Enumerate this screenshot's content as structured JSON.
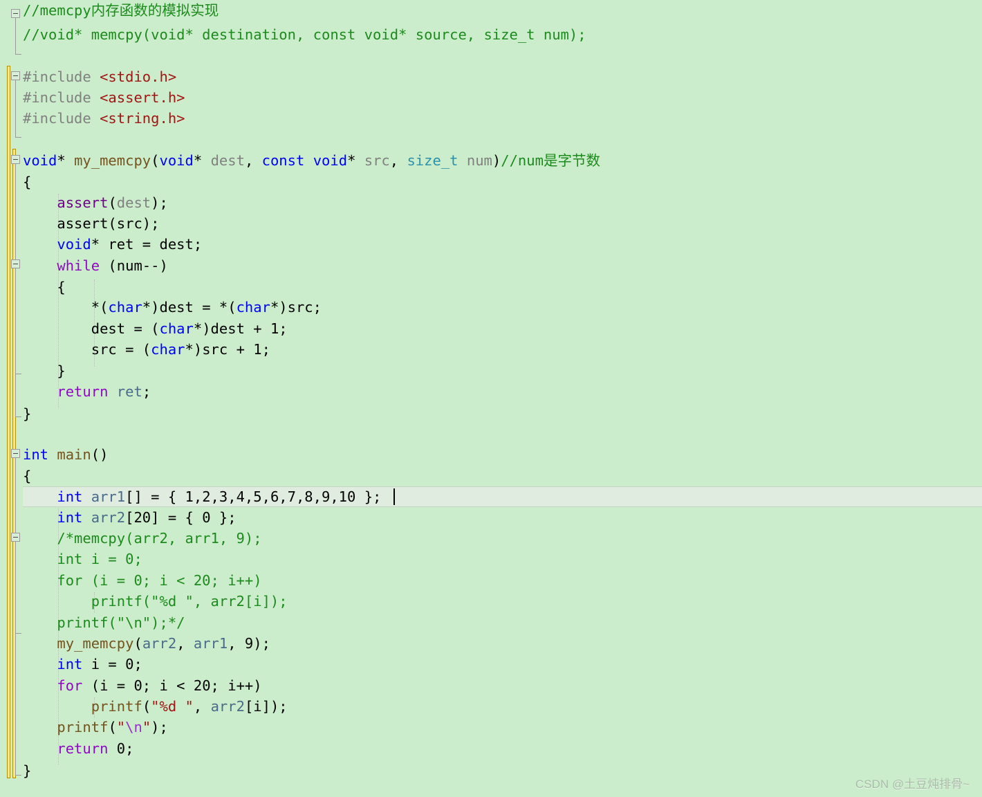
{
  "editor": {
    "name": "visual-studio-code-editor",
    "language": "C",
    "background_color": "#cbedcb",
    "current_line_color": "#dfecdf",
    "change_bar_color": "#f5e79a",
    "font_size_px": 20.5,
    "line_height_px": 30
  },
  "palette": {
    "comment": "#1d8a1d",
    "keyword": "#0000ff",
    "control_keyword": "#8f08c4",
    "preprocessor": "#808080",
    "include_path": "#a31515",
    "string": "#a31515",
    "escape": "#9a2ece",
    "type": "#2b91af",
    "function": "#74531f",
    "variable": "#4a6a8a",
    "parameter": "#808080",
    "macro": "#6f008a",
    "plain": "#000000"
  },
  "caret": {
    "line_index": 24,
    "column_after": "int arr1[] = { 1,2,3,4,5,6,7,8,9,10 };"
  },
  "current_line": {
    "index": 24,
    "text": "    int arr1[] = { 1,2,3,4,5,6,7,8,9,10 };"
  },
  "watermark": {
    "text": "CSDN @土豆炖排骨~"
  },
  "code_lines": [
    {
      "n": 1,
      "indent": 0,
      "text": "//memcpy内存函数的模拟实现"
    },
    {
      "n": 2,
      "indent": 0,
      "text": "//void* memcpy(void* destination, const void* source, size_t num);"
    },
    {
      "n": 3,
      "indent": 0,
      "text": ""
    },
    {
      "n": 4,
      "indent": 0,
      "text": "#include <stdio.h>"
    },
    {
      "n": 5,
      "indent": 0,
      "text": "#include <assert.h>"
    },
    {
      "n": 6,
      "indent": 0,
      "text": "#include <string.h>"
    },
    {
      "n": 7,
      "indent": 0,
      "text": ""
    },
    {
      "n": 8,
      "indent": 0,
      "text": "void* my_memcpy(void* dest, const void* src, size_t num)//num是字节数"
    },
    {
      "n": 9,
      "indent": 0,
      "text": "{"
    },
    {
      "n": 10,
      "indent": 1,
      "text": "    assert(dest);"
    },
    {
      "n": 11,
      "indent": 1,
      "text": "    assert(src);"
    },
    {
      "n": 12,
      "indent": 1,
      "text": "    void* ret = dest;"
    },
    {
      "n": 13,
      "indent": 1,
      "text": "    while (num--)"
    },
    {
      "n": 14,
      "indent": 1,
      "text": "    {"
    },
    {
      "n": 15,
      "indent": 2,
      "text": "        *(char*)dest = *(char*)src;"
    },
    {
      "n": 16,
      "indent": 2,
      "text": "        dest = (char*)dest + 1;"
    },
    {
      "n": 17,
      "indent": 2,
      "text": "        src = (char*)src + 1;"
    },
    {
      "n": 18,
      "indent": 1,
      "text": "    }"
    },
    {
      "n": 19,
      "indent": 1,
      "text": "    return ret;"
    },
    {
      "n": 20,
      "indent": 0,
      "text": "}"
    },
    {
      "n": 21,
      "indent": 0,
      "text": ""
    },
    {
      "n": 22,
      "indent": 0,
      "text": "int main()"
    },
    {
      "n": 23,
      "indent": 0,
      "text": "{"
    },
    {
      "n": 24,
      "indent": 1,
      "text": "    int arr1[] = { 1,2,3,4,5,6,7,8,9,10 };"
    },
    {
      "n": 25,
      "indent": 1,
      "text": "    int arr2[20] = { 0 };"
    },
    {
      "n": 26,
      "indent": 1,
      "text": "    /*memcpy(arr2, arr1, 9);"
    },
    {
      "n": 27,
      "indent": 1,
      "text": "    int i = 0;"
    },
    {
      "n": 28,
      "indent": 1,
      "text": "    for (i = 0; i < 20; i++)"
    },
    {
      "n": 29,
      "indent": 2,
      "text": "        printf(\"%d \", arr2[i]);"
    },
    {
      "n": 30,
      "indent": 1,
      "text": "    printf(\"\\n\");*/"
    },
    {
      "n": 31,
      "indent": 1,
      "text": "    my_memcpy(arr2, arr1, 9);"
    },
    {
      "n": 32,
      "indent": 1,
      "text": "    int i = 0;"
    },
    {
      "n": 33,
      "indent": 1,
      "text": "    for (i = 0; i < 20; i++)"
    },
    {
      "n": 34,
      "indent": 2,
      "text": "        printf(\"%d \", arr2[i]);"
    },
    {
      "n": 35,
      "indent": 1,
      "text": "    printf(\"\\n\");"
    },
    {
      "n": 36,
      "indent": 1,
      "text": "    return 0;"
    },
    {
      "n": 37,
      "indent": 0,
      "text": "}"
    }
  ],
  "tokens": {
    "l1": [
      [
        "//memcpy内存函数的模拟实现",
        "cmt"
      ]
    ],
    "l2": [
      [
        "//void* memcpy(void* destination, const void* source, size_t num);",
        "cmt"
      ]
    ],
    "l4": [
      [
        "#include ",
        "pre"
      ],
      [
        "<stdio.h>",
        "inc"
      ]
    ],
    "l5": [
      [
        "#include ",
        "pre"
      ],
      [
        "<assert.h>",
        "inc"
      ]
    ],
    "l6": [
      [
        "#include ",
        "pre"
      ],
      [
        "<string.h>",
        "inc"
      ]
    ],
    "l8": [
      [
        "void",
        "kw"
      ],
      [
        "* ",
        "plain"
      ],
      [
        "my_memcpy",
        "fn"
      ],
      [
        "(",
        "plain"
      ],
      [
        "void",
        "kw"
      ],
      [
        "* ",
        "plain"
      ],
      [
        "dest",
        "param"
      ],
      [
        ", ",
        "plain"
      ],
      [
        "const",
        "kw"
      ],
      [
        " ",
        "plain"
      ],
      [
        "void",
        "kw"
      ],
      [
        "* ",
        "plain"
      ],
      [
        "src",
        "param"
      ],
      [
        ", ",
        "plain"
      ],
      [
        "size_t",
        "type"
      ],
      [
        " ",
        "plain"
      ],
      [
        "num",
        "param"
      ],
      [
        ")",
        "plain"
      ],
      [
        "//num是字节数",
        "cmt"
      ]
    ],
    "l9": [
      [
        "{",
        "plain"
      ]
    ],
    "l10": [
      [
        "    ",
        "plain"
      ],
      [
        "assert",
        "macro"
      ],
      [
        "(",
        "plain"
      ],
      [
        "dest",
        "param"
      ],
      [
        ");",
        "plain"
      ]
    ],
    "l11": [
      [
        "    assert(src);",
        "plain"
      ]
    ],
    "l12": [
      [
        "    ",
        "plain"
      ],
      [
        "void",
        "kw"
      ],
      [
        "* ret = dest;",
        "plain"
      ]
    ],
    "l13": [
      [
        "    ",
        "plain"
      ],
      [
        "while",
        "ctl"
      ],
      [
        " (num--)",
        "plain"
      ]
    ],
    "l14": [
      [
        "    {",
        "plain"
      ]
    ],
    "l15": [
      [
        "        *(",
        "plain"
      ],
      [
        "char",
        "kw"
      ],
      [
        "*)dest = *(",
        "plain"
      ],
      [
        "char",
        "kw"
      ],
      [
        "*)src;",
        "plain"
      ]
    ],
    "l16": [
      [
        "        dest = (",
        "plain"
      ],
      [
        "char",
        "kw"
      ],
      [
        "*)dest + 1;",
        "plain"
      ]
    ],
    "l17": [
      [
        "        src = (",
        "plain"
      ],
      [
        "char",
        "kw"
      ],
      [
        "*)src + 1;",
        "plain"
      ]
    ],
    "l18": [
      [
        "    }",
        "plain"
      ]
    ],
    "l19": [
      [
        "    ",
        "plain"
      ],
      [
        "return",
        "ctl"
      ],
      [
        " ",
        "plain"
      ],
      [
        "ret",
        "var"
      ],
      [
        ";",
        "plain"
      ]
    ],
    "l20": [
      [
        "}",
        "plain"
      ]
    ],
    "l22": [
      [
        "int",
        "kw"
      ],
      [
        " ",
        "plain"
      ],
      [
        "main",
        "fn"
      ],
      [
        "()",
        "plain"
      ]
    ],
    "l23": [
      [
        "{",
        "plain"
      ]
    ],
    "l24": [
      [
        "    ",
        "plain"
      ],
      [
        "int",
        "kw"
      ],
      [
        " ",
        "plain"
      ],
      [
        "arr1",
        "var"
      ],
      [
        "[] = { 1,2,3,4,5,6,7,8,9,10 };",
        "plain"
      ]
    ],
    "l25": [
      [
        "    ",
        "plain"
      ],
      [
        "int",
        "kw"
      ],
      [
        " ",
        "plain"
      ],
      [
        "arr2",
        "var"
      ],
      [
        "[20] = { 0 };",
        "plain"
      ]
    ],
    "l26": [
      [
        "    /*memcpy(arr2, arr1, 9);",
        "cmt"
      ]
    ],
    "l27": [
      [
        "    int i = 0;",
        "cmt"
      ]
    ],
    "l28": [
      [
        "    for (i = 0; i < 20; i++)",
        "cmt"
      ]
    ],
    "l29": [
      [
        "        printf(\"%d \", arr2[i]);",
        "cmt"
      ]
    ],
    "l30": [
      [
        "    printf(\"\\n\");*/",
        "cmt"
      ]
    ],
    "l31": [
      [
        "    ",
        "plain"
      ],
      [
        "my_memcpy",
        "fn"
      ],
      [
        "(",
        "plain"
      ],
      [
        "arr2",
        "var"
      ],
      [
        ", ",
        "plain"
      ],
      [
        "arr1",
        "var"
      ],
      [
        ", 9);",
        "plain"
      ]
    ],
    "l32": [
      [
        "    ",
        "plain"
      ],
      [
        "int",
        "kw"
      ],
      [
        " i = 0;",
        "plain"
      ]
    ],
    "l33": [
      [
        "    ",
        "plain"
      ],
      [
        "for",
        "ctl"
      ],
      [
        " (i = 0; i < 20; i++)",
        "plain"
      ]
    ],
    "l34": [
      [
        "        ",
        "plain"
      ],
      [
        "printf",
        "fn"
      ],
      [
        "(",
        "plain"
      ],
      [
        "\"%d \"",
        "str"
      ],
      [
        ", ",
        "plain"
      ],
      [
        "arr2",
        "var"
      ],
      [
        "[i]);",
        "plain"
      ]
    ],
    "l35": [
      [
        "    ",
        "plain"
      ],
      [
        "printf",
        "fn"
      ],
      [
        "(",
        "plain"
      ],
      [
        "\"",
        "str"
      ],
      [
        "\\n",
        "esc"
      ],
      [
        "\"",
        "str"
      ],
      [
        ");",
        "plain"
      ]
    ],
    "l36": [
      [
        "    ",
        "plain"
      ],
      [
        "return",
        "ctl"
      ],
      [
        " 0;",
        "plain"
      ]
    ],
    "l37": [
      [
        "}",
        "plain"
      ]
    ]
  }
}
